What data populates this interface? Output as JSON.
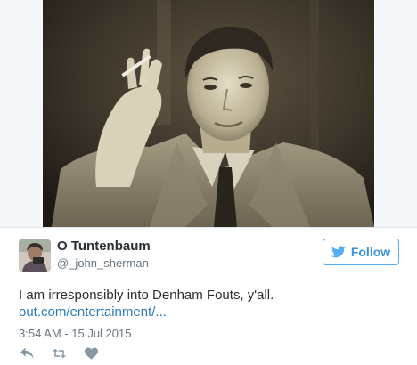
{
  "tweet": {
    "display_name": "O Tuntenbaum",
    "handle": "@_john_sherman",
    "text": "I am irresponsibly into Denham Fouts, y'all.",
    "link": "out.com/entertainment/...",
    "timestamp": "3:54 AM - 15 Jul 2015"
  },
  "follow_button": {
    "label": "Follow",
    "icon": "twitter-bird-icon"
  },
  "actions": [
    {
      "name": "reply",
      "icon": "reply-icon"
    },
    {
      "name": "retweet",
      "icon": "retweet-icon"
    },
    {
      "name": "like",
      "icon": "heart-icon"
    }
  ],
  "colors": {
    "accent": "#55acee",
    "follow_text": "#3b94d9",
    "link": "#2b7bb9",
    "text": "#292f33",
    "secondary_text": "#66757f",
    "action_icon": "#8899a6",
    "border": "#e1e8ed"
  }
}
